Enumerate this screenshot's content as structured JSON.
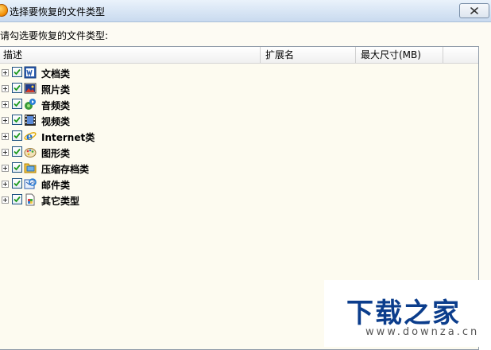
{
  "window": {
    "title": "选择要恢复的文件类型",
    "close_label": "close"
  },
  "prompt": "请勾选要恢复的文件类型:",
  "table": {
    "columns": [
      "描述",
      "扩展名",
      "最大尺寸(MB)",
      ""
    ],
    "rows": [
      {
        "label": "文档类",
        "icon": "word-document-icon",
        "checked": true
      },
      {
        "label": "照片类",
        "icon": "photo-icon",
        "checked": true
      },
      {
        "label": "音频类",
        "icon": "audio-icon",
        "checked": true
      },
      {
        "label": "视频类",
        "icon": "video-film-icon",
        "checked": true
      },
      {
        "label": "Internet类",
        "icon": "internet-explorer-icon",
        "checked": true
      },
      {
        "label": "图形类",
        "icon": "graphics-palette-icon",
        "checked": true
      },
      {
        "label": "压缩存档类",
        "icon": "archive-folder-icon",
        "checked": true
      },
      {
        "label": "邮件类",
        "icon": "mail-icon",
        "checked": true
      },
      {
        "label": "其它类型",
        "icon": "other-file-icon",
        "checked": true
      }
    ]
  },
  "watermark": {
    "title": "下载之家",
    "url": "www.downza.cn"
  },
  "colors": {
    "list_background": "#fdfbf0",
    "checkbox_border": "#1c5180",
    "check_mark": "#1c9a1c",
    "watermark_blue": "#0b3d8c"
  }
}
